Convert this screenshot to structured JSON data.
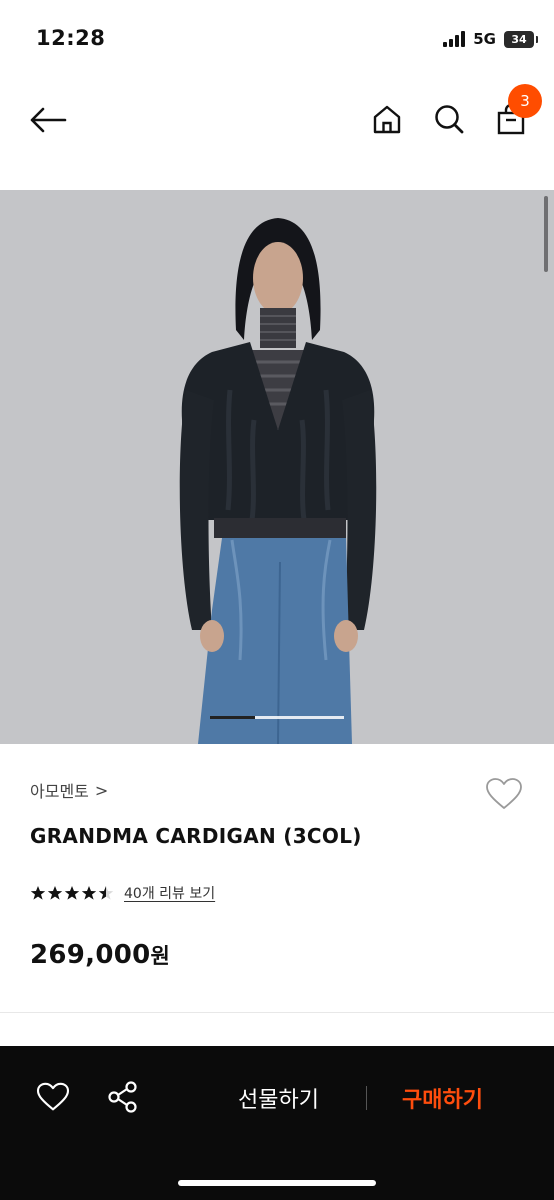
{
  "status_bar": {
    "time": "12:28",
    "network": "5G",
    "battery": "34"
  },
  "header": {
    "cart_count": "3"
  },
  "product": {
    "brand": "아모멘토",
    "brand_chevron": ">",
    "name": "GRANDMA CARDIGAN (3COL)",
    "rating": 4.5,
    "rating_max": 5,
    "review_link": "40개 리뷰 보기",
    "price_amount": "269,000",
    "price_unit": "원"
  },
  "gallery": {
    "pages": 3,
    "current_page": 1
  },
  "bottom_bar": {
    "gift_label": "선물하기",
    "buy_label": "구매하기"
  },
  "colors": {
    "accent": "#ff4d00",
    "bottom_bar_bg": "#0b0b0b",
    "image_bg": "#c4c5c8"
  }
}
